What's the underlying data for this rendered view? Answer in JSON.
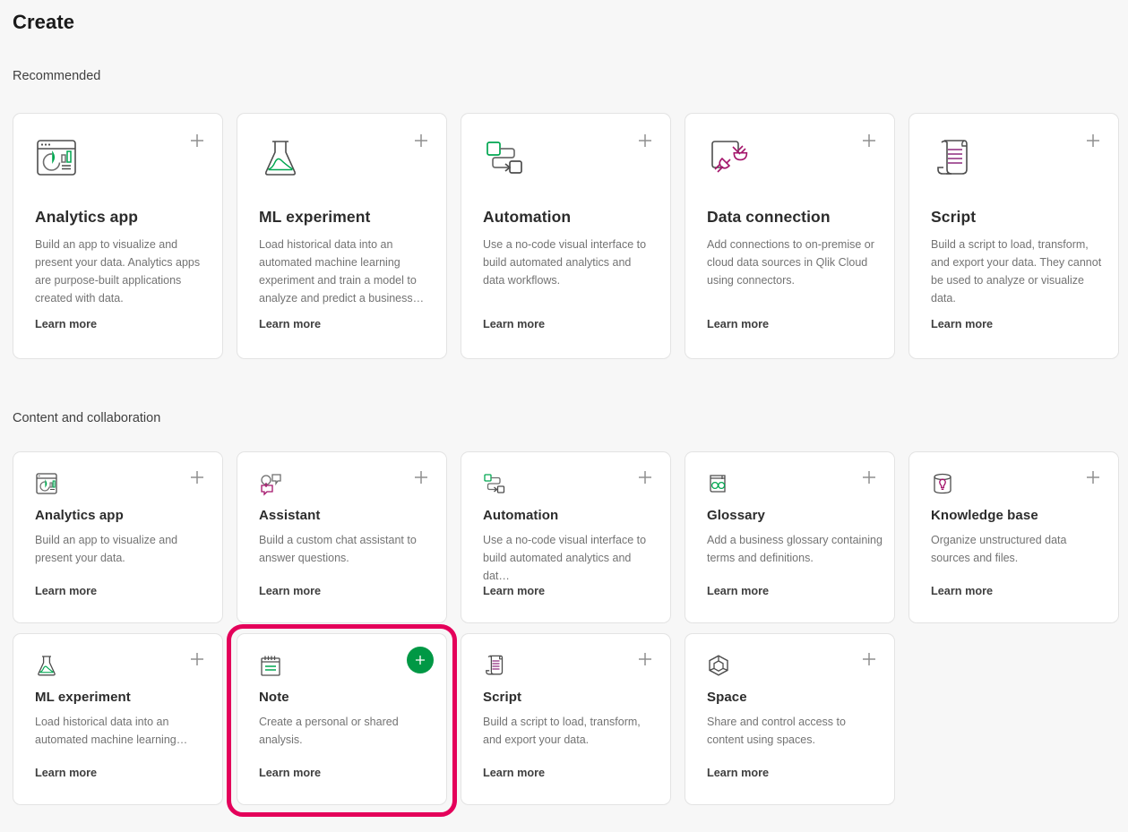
{
  "page": {
    "title": "Create",
    "background_color": "#f7f7f7",
    "accent_green": "#009845",
    "highlight_border_color": "#e4005a"
  },
  "sections": [
    {
      "id": "recommended",
      "title": "Recommended",
      "cards": [
        {
          "icon": "analytics-app-icon",
          "title": "Analytics app",
          "description": "Build an app to visualize and present your data. Analytics apps are purpose-built applications created with data.",
          "link": "Learn more",
          "add_label": "+"
        },
        {
          "icon": "ml-experiment-flask-icon",
          "title": "ML experiment",
          "description": "Load historical data into an automated machine learning experiment and train a model to analyze and predict a business…",
          "link": "Learn more",
          "add_label": "+"
        },
        {
          "icon": "automation-flow-icon",
          "title": "Automation",
          "description": "Use a no-code visual interface to build automated analytics and data workflows.",
          "link": "Learn more",
          "add_label": "+"
        },
        {
          "icon": "data-connection-plug-icon",
          "title": "Data connection",
          "description": "Add connections to on-premise or cloud data sources in Qlik Cloud using connectors.",
          "link": "Learn more",
          "add_label": "+"
        },
        {
          "icon": "script-scroll-icon",
          "title": "Script",
          "description": "Build a script to load, transform, and export your data. They cannot be used to analyze or visualize data.",
          "link": "Learn more",
          "add_label": "+"
        }
      ]
    },
    {
      "id": "content-and-collaboration",
      "title": "Content and collaboration",
      "cards": [
        {
          "icon": "analytics-app-icon",
          "title": "Analytics app",
          "description": "Build an app to visualize and present your data.",
          "link": "Learn more",
          "add_label": "+"
        },
        {
          "icon": "assistant-chat-icon",
          "title": "Assistant",
          "description": "Build a custom chat assistant to answer questions.",
          "link": "Learn more",
          "add_label": "+"
        },
        {
          "icon": "automation-flow-icon",
          "title": "Automation",
          "description": "Use a no-code visual interface to build automated analytics and dat…",
          "link": "Learn more",
          "add_label": "+"
        },
        {
          "icon": "glossary-book-icon",
          "title": "Glossary",
          "description": "Add a business glossary containing terms and definitions.",
          "link": "Learn more",
          "add_label": "+"
        },
        {
          "icon": "knowledge-base-icon",
          "title": "Knowledge base",
          "description": "Organize unstructured data sources and files.",
          "link": "Learn more",
          "add_label": "+"
        },
        {
          "icon": "ml-experiment-flask-icon",
          "title": "ML experiment",
          "description": "Load historical data into an automated machine learning…",
          "link": "Learn more",
          "add_label": "+"
        },
        {
          "icon": "note-icon",
          "title": "Note",
          "description": "Create a personal or shared analysis.",
          "link": "Learn more",
          "add_label": "+",
          "highlighted": true,
          "add_button_active": true
        },
        {
          "icon": "script-scroll-icon",
          "title": "Script",
          "description": "Build a script to load, transform, and export your data.",
          "link": "Learn more",
          "add_label": "+"
        },
        {
          "icon": "space-cube-icon",
          "title": "Space",
          "description": "Share and control access to content using spaces.",
          "link": "Learn more",
          "add_label": "+"
        }
      ]
    }
  ]
}
